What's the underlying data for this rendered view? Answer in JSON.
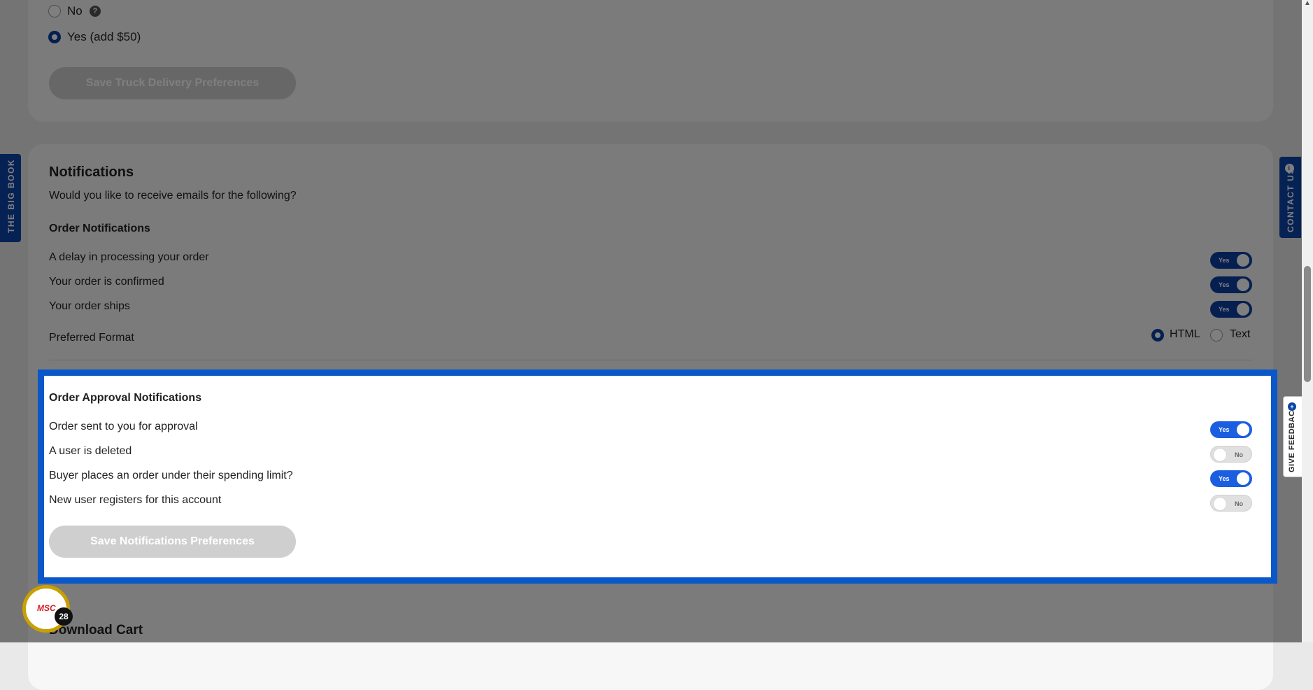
{
  "truck_delivery": {
    "options": [
      {
        "label": "No",
        "selected": false
      },
      {
        "label": "Yes (add $50)",
        "selected": true
      }
    ],
    "save_label": "Save Truck Delivery Preferences"
  },
  "notifications": {
    "title": "Notifications",
    "subtitle": "Would you like to receive emails for the following?",
    "order_section": {
      "heading": "Order Notifications",
      "items": [
        {
          "label": "A delay in processing your order",
          "toggle": "Yes"
        },
        {
          "label": "Your order is confirmed",
          "toggle": "Yes"
        },
        {
          "label": "Your order ships",
          "toggle": "Yes"
        }
      ],
      "format_label": "Preferred Format",
      "format_options": [
        {
          "label": "HTML",
          "selected": true
        },
        {
          "label": "Text",
          "selected": false
        }
      ]
    },
    "approval_section": {
      "heading": "Order Approval Notifications",
      "items": [
        {
          "label": "Order sent to you for approval",
          "toggle": "Yes"
        },
        {
          "label": "A user is deleted",
          "toggle": "No"
        },
        {
          "label": "Buyer places an order under their spending limit?",
          "toggle": "Yes"
        },
        {
          "label": "New user registers for this account",
          "toggle": "No"
        }
      ]
    },
    "save_label": "Save Notifications Preferences"
  },
  "download_cart": {
    "title": "Download Cart"
  },
  "side_tabs": {
    "left": "THE BIG BOOK",
    "contact": "CONTACT US",
    "feedback": "GIVE FEEDBACK"
  },
  "badge": {
    "logo": "MSC",
    "count": "28"
  },
  "colors": {
    "accent": "#0b3ea3",
    "highlight_border": "#0a57c9",
    "badge_ring": "#c8a100"
  }
}
